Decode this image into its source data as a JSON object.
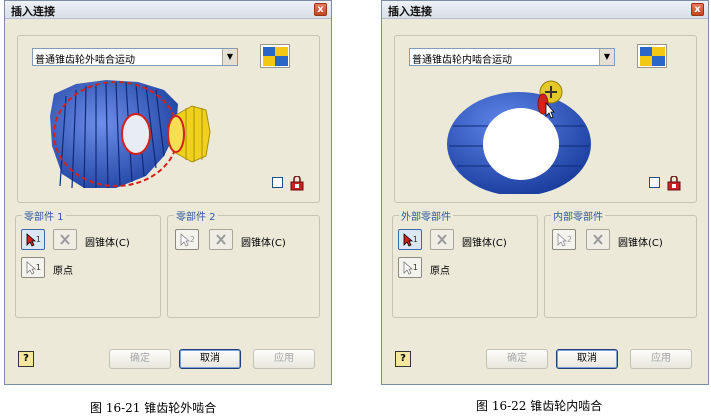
{
  "dialogs": [
    {
      "title": "插入连接",
      "close_label": "x",
      "joint_type": "普通锥齿轮外啮合运动",
      "dropdown_arrow": "▼",
      "group1": {
        "legend": "零部件 1",
        "button_num": "1",
        "label": "圆锥体(C)",
        "origin_num": "1",
        "origin_label": "原点"
      },
      "group2": {
        "legend": "零部件 2",
        "button_num": "2",
        "label": "圆锥体(C)"
      },
      "help_label": "?",
      "buttons": {
        "ok": "确定",
        "cancel": "取消",
        "apply": "应用"
      },
      "caption": "图 16-21 锥齿轮外啮合"
    },
    {
      "title": "插入连接",
      "close_label": "x",
      "joint_type": "普通锥齿轮内啮合运动",
      "dropdown_arrow": "▼",
      "group1": {
        "legend": "外部零部件",
        "button_num": "1",
        "label": "圆锥体(C)",
        "origin_num": "1",
        "origin_label": "原点"
      },
      "group2": {
        "legend": "内部零部件",
        "button_num": "2",
        "label": "圆锥体(C)"
      },
      "help_label": "?",
      "buttons": {
        "ok": "确定",
        "cancel": "取消",
        "apply": "应用"
      },
      "caption": "图 16-22 锥齿轮内啮合"
    }
  ],
  "colors": {
    "gear_blue": "#2a55c4",
    "gear_yellow": "#f0d21e",
    "highlight_red": "#d4211a",
    "legend_blue": "#2c5aa0"
  },
  "icons": [
    "close-icon",
    "chevron-down-icon",
    "motion-type-icon",
    "select-pointer-icon",
    "flip-icon",
    "lock-icon",
    "help-icon"
  ]
}
